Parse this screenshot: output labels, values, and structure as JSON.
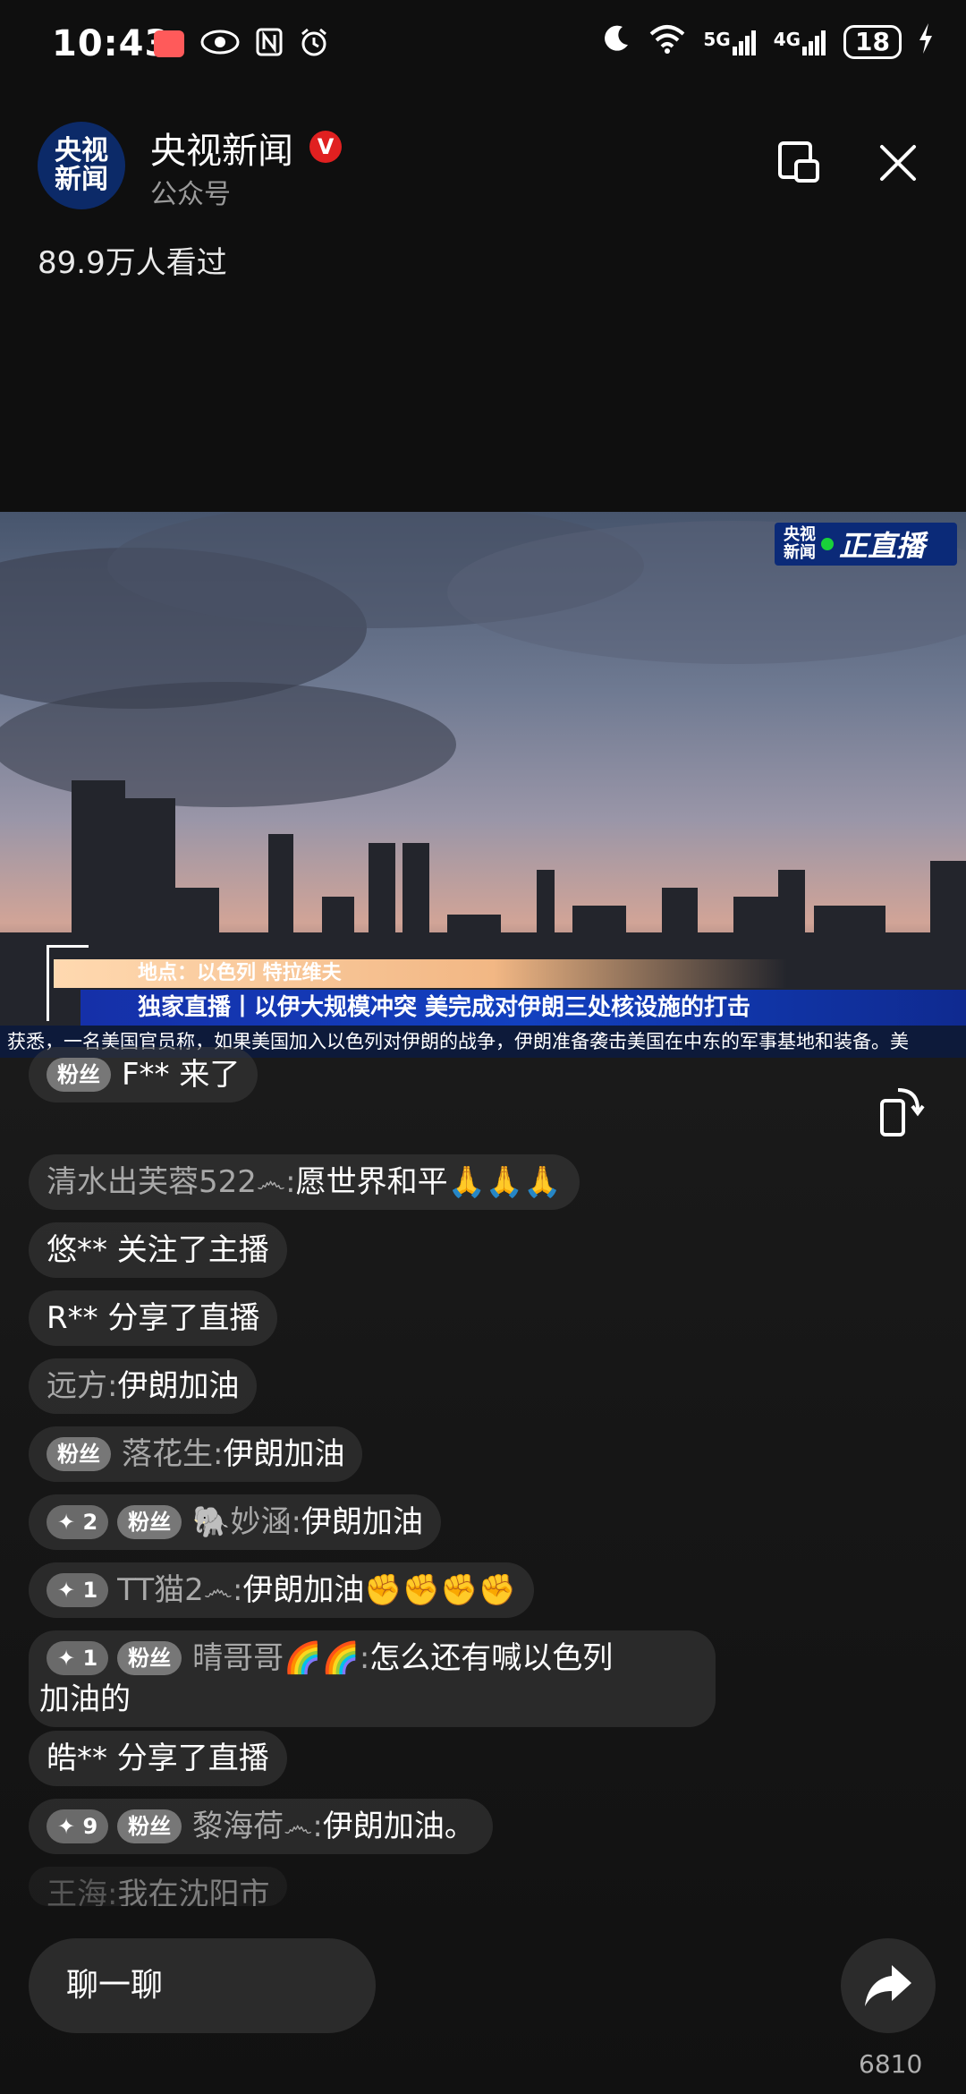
{
  "status_bar": {
    "time": "10:43",
    "battery": "18",
    "network_5g": "5G",
    "network_4g": "4G",
    "icons": [
      "app-notification-icon",
      "eye-icon",
      "nfc-icon",
      "alarm-icon",
      "moon-icon",
      "wifi-icon",
      "signal-5g-icon",
      "signal-4g-icon",
      "battery-icon",
      "charging-icon"
    ]
  },
  "header": {
    "avatar_line1": "央视",
    "avatar_line2": "新闻",
    "channel_name": "央视新闻",
    "verified_mark": "V",
    "channel_type": "公众号",
    "viewers": "89.9万人看过"
  },
  "video": {
    "badge_logo_line1": "央视",
    "badge_logo_line2": "新闻",
    "badge_live": "正直播",
    "location": "地点：以色列 特拉维夫",
    "headline": "独家直播丨以伊大规模冲突 美完成对伊朗三处核设施的打击",
    "ticker": "获悉，一名美国官员称，如果美国加入以色列对伊朗的战争，伊朗准备袭击美国在中东的军事基地和装备。美"
  },
  "comments": [
    {
      "fan_badge": "粉丝",
      "text": "F** 来了"
    },
    {
      "user": "清水出芙蓉522෴: ",
      "text": "愿世界和平🙏🙏🙏"
    },
    {
      "text": "悠** 关注了主播"
    },
    {
      "text": "R** 分享了直播"
    },
    {
      "user": "远方: ",
      "text": "伊朗加油"
    },
    {
      "fan_badge": "粉丝",
      "user": "落花生: ",
      "text": "伊朗加油"
    },
    {
      "plus_badge": "✦ 2",
      "fan_badge": "粉丝",
      "user": "🐘妙涵: ",
      "text": "伊朗加油"
    },
    {
      "plus_badge": "✦ 1",
      "user": "TT猫2෴: ",
      "text": "伊朗加油✊✊✊✊"
    },
    {
      "plus_badge": "✦ 1",
      "fan_badge": "粉丝",
      "user": "晴哥哥🌈🌈: ",
      "text": "怎么还有喊以色列",
      "text2": "加油的"
    },
    {
      "text": "皓** 分享了直播"
    },
    {
      "plus_badge": "✦ 9",
      "fan_badge": "粉丝",
      "user": "黎海荷෴: ",
      "text": "伊朗加油。"
    },
    {
      "user": "王海: ",
      "text": "我在沈阳市"
    }
  ],
  "bottom": {
    "chat_placeholder": "聊一聊",
    "share_count": "6810"
  },
  "colors": {
    "background": "#0f0f0f",
    "bubble": "#3c3c3c",
    "verified_red": "#e02020",
    "live_green": "#19d23a",
    "cctv_blue": "#0b2a78"
  }
}
